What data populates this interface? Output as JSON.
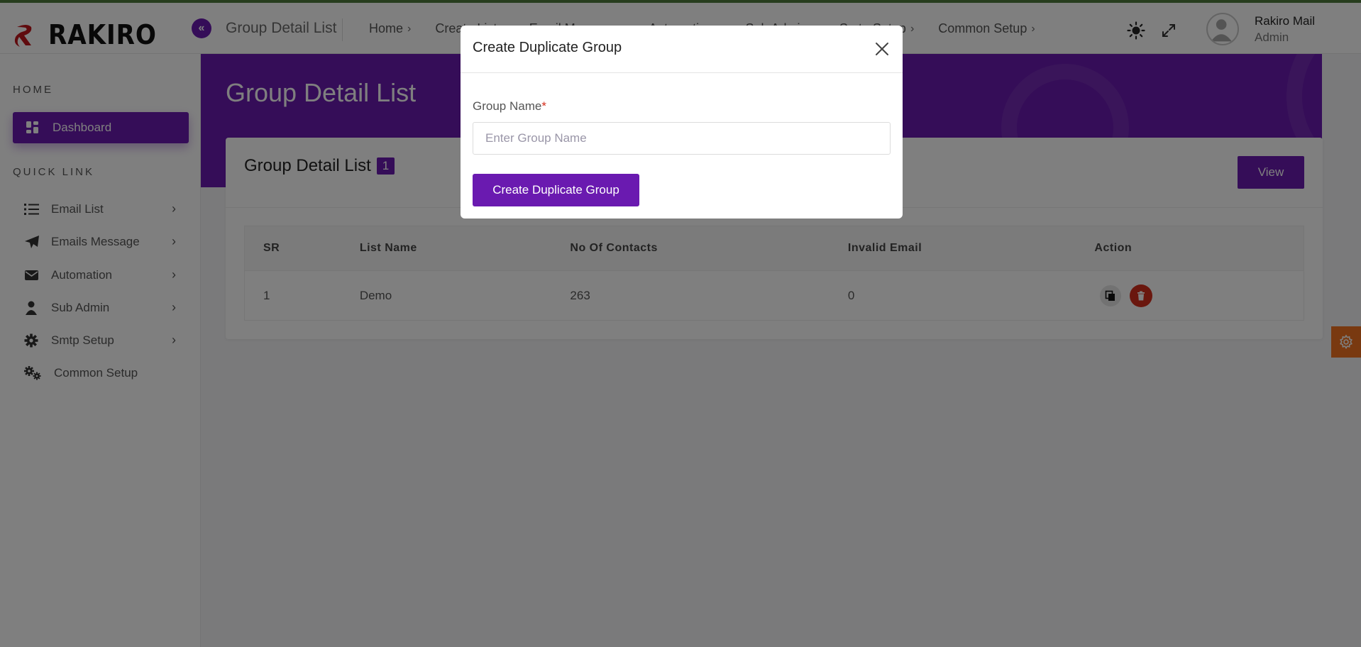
{
  "header": {
    "brand": "RAKIRO",
    "page_title": "Group Detail List",
    "nav": [
      {
        "label": "Home"
      },
      {
        "label": "Create List"
      },
      {
        "label": "Email Message"
      },
      {
        "label": "Automation"
      },
      {
        "label": "Sub Admin"
      },
      {
        "label": "Smtp Setup"
      },
      {
        "label": "Common Setup"
      }
    ],
    "user": {
      "name": "Rakiro Mail",
      "role": "Admin"
    }
  },
  "sidebar": {
    "home_heading": "HOME",
    "dashboard_label": "Dashboard",
    "quick_link_heading": "QUICK LINK",
    "items": [
      {
        "label": "Email List",
        "icon": "list-icon"
      },
      {
        "label": "Emails Message",
        "icon": "paper-plane-icon"
      },
      {
        "label": "Automation",
        "icon": "envelope-icon"
      },
      {
        "label": "Sub Admin",
        "icon": "user-icon"
      },
      {
        "label": "Smtp Setup",
        "icon": "gear-icon"
      },
      {
        "label": "Common Setup",
        "icon": "gears-icon"
      }
    ]
  },
  "main": {
    "hero_title": "Group Detail List",
    "card_title": "Group Detail List",
    "count": "1",
    "view_label": "View",
    "table": {
      "columns": [
        "SR",
        "List Name",
        "No Of Contacts",
        "Invalid Email",
        "Action"
      ],
      "rows": [
        {
          "sr": "1",
          "list_name": "Demo",
          "contacts": "263",
          "invalid": "0"
        }
      ]
    }
  },
  "modal": {
    "title": "Create Duplicate Group",
    "field_label": "Group Name",
    "required_mark": "*",
    "input_value": "",
    "input_placeholder": "Enter Group Name",
    "submit_label": "Create Duplicate Group"
  },
  "colors": {
    "accent": "#6a1ab0",
    "danger": "#d42e1c",
    "settings_tab": "#f37321"
  }
}
